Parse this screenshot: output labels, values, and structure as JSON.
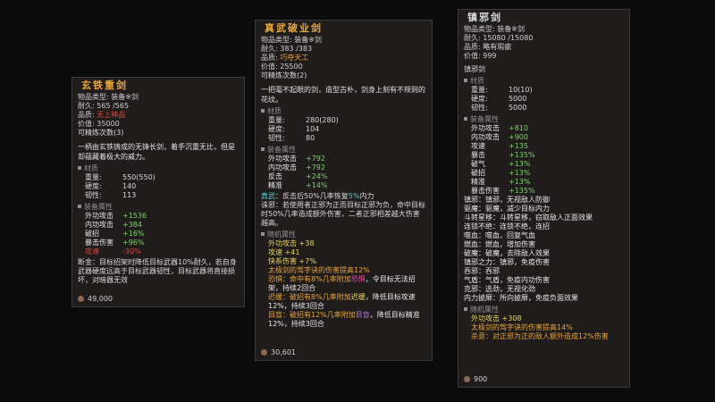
{
  "panels": [
    {
      "title": "玄铁重剑",
      "type_label": "物品类型:",
      "type_value": "装备※剑",
      "durability_label": "耐久:",
      "durability_value": "565 /565",
      "quality_label": "品质:",
      "quality_value": "无上神品",
      "price_label": "价值:",
      "price_value": "35000",
      "refine_label": "可精炼次数(3)",
      "description": "一柄由玄铁铸成的无锋长剑，着手沉重无比，但是却蕴藏着极大的威力。",
      "material_header": "材质",
      "material": [
        [
          "重量:",
          "550(550)"
        ],
        [
          "硬度:",
          "140"
        ],
        [
          "韧性:",
          "113"
        ]
      ],
      "attr_header": "装备属性",
      "attrs": [
        [
          "外功攻击",
          "+1536"
        ],
        [
          "内功攻击",
          "+384"
        ],
        [
          "破招",
          "+16%"
        ],
        [
          "暴击伤害",
          "+96%"
        ],
        [
          "攻速",
          "-30%"
        ]
      ],
      "effect": "断金：目标招架时降低目标武器10%耐久，若自身武器硬度远高于目标武器韧性，目标武器将直接损坏，对暗器无效",
      "money": "49,000"
    },
    {
      "title": "真武破业剑",
      "type_label": "物品类型:",
      "type_value": "装备※剑",
      "durability_label": "耐久:",
      "durability_value": "383 /383",
      "quality_label": "品质:",
      "quality_value": "巧夺天工",
      "price_label": "价值:",
      "price_value": "25500",
      "refine_label": "可精炼次数(2)",
      "description": "一把毫不起眼的剑，造型古朴，剑身上刻有不规则的花纹。",
      "material_header": "材质",
      "material": [
        [
          "重量:",
          "280(280)"
        ],
        [
          "硬度:",
          "104"
        ],
        [
          "韧性:",
          "80"
        ]
      ],
      "attr_header": "装备属性",
      "attrs": [
        [
          "外功攻击",
          "+792"
        ],
        [
          "内功攻击",
          "+792"
        ],
        [
          "反击",
          "+24%"
        ],
        [
          "精准",
          "+14%"
        ]
      ],
      "effect1_name": "真武",
      "effect1": "：反击后50%几率恢复",
      "effect1_pct": "5%",
      "effect1_tail": "内力",
      "effect2": "诛邪：若使用者正邪为正而目标正邪为负，命中目标时50%几率造成额外伤害，二者正邪相差越大伤害越高。",
      "random_header": "随机属性",
      "random": [
        {
          "text": "外功攻击 +38",
          "color": "yellow"
        },
        {
          "text": "攻速 +41",
          "color": "yellow"
        },
        {
          "text": "快系伤害 +7%",
          "color": "yellow"
        },
        {
          "text": "太极剑的驾字诀的伤害提高12%",
          "color": "orange"
        }
      ],
      "random_fear_pre": "恐惧：命中有8%几率附加",
      "random_fear_key": "恐惧",
      "random_fear_mid": "，令目标无法招架，持续2回合",
      "random_slow_pre": "迟缓：破招有8%几率附加",
      "random_slow_key": "迟缓",
      "random_slow_mid": "，降低目标攻速12%，持续3回合",
      "random_blind_pre": "目盲：破招有12%几率附加",
      "random_blind_key": "目盲",
      "random_blind_mid": "，降低目标精准12%，持续3回合",
      "money": "30,601"
    },
    {
      "title": "镇邪剑",
      "type_label": "物品类型:",
      "type_value": "装备※剑",
      "durability_label": "耐久:",
      "durability_value": "15080 /15080",
      "quality_label": "品质:",
      "quality_value": "略有瑕疵",
      "price_label": "价值:",
      "price_value": "999",
      "subname": "镇邪剑",
      "material_header": "材质",
      "material": [
        [
          "重量:",
          "10(10)"
        ],
        [
          "硬度:",
          "5000"
        ],
        [
          "韧性:",
          "5000"
        ]
      ],
      "attr_header": "装备属性",
      "attrs": [
        [
          "外功攻击",
          "+810"
        ],
        [
          "内功攻击",
          "+900"
        ],
        [
          "攻速",
          "+135"
        ],
        [
          "暴击",
          "+135%"
        ],
        [
          "破气",
          "+13%"
        ],
        [
          "破招",
          "+13%"
        ],
        [
          "精准",
          "+13%"
        ],
        [
          "暴击伤害",
          "+135%"
        ]
      ],
      "effects": [
        "镇邪：镇邪，无视敌人防御",
        "驱魔：驱魔，减少目标内力",
        "斗转星移：斗转星移，窃取敌人正面效果",
        "连锁不绝：连锁不绝，连招",
        "噬血：噬血，回复气血",
        "燃血：燃血，增加伤害",
        "破魔：破魔，去除敌人效果",
        "镇邪之力：镇邪，免疫伤害",
        "吞邪：吞邪",
        "气盾：气盾，免疫内功伤害",
        "克邪：选劲，无视化劲",
        "内力披靡：所向披靡，免疫负面效果"
      ],
      "random_header": "随机属性",
      "random": [
        {
          "text": "外功攻击 +308",
          "color": "yellow"
        },
        {
          "text": "太极剑的驾字诀的伤害提高14%",
          "color": "orange"
        },
        {
          "text": "杀意：对正邪为正的敌人额外造成12%伤害",
          "color": "orange"
        }
      ],
      "money": "900"
    }
  ]
}
